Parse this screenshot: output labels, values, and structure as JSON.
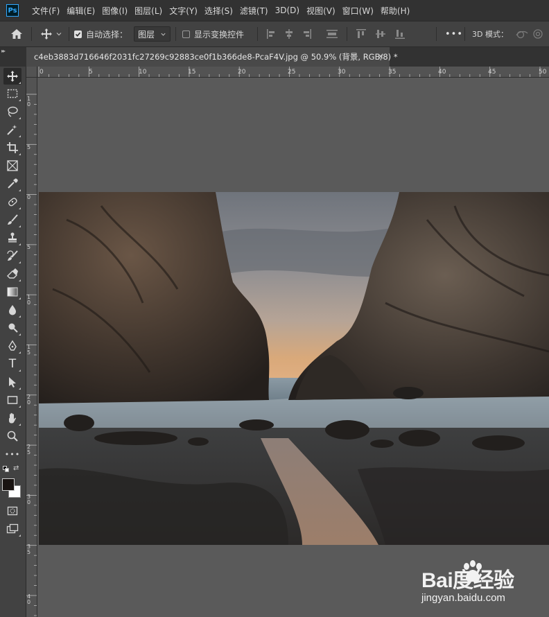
{
  "app": {
    "logo": "Ps"
  },
  "menu": [
    "文件(F)",
    "编辑(E)",
    "图像(I)",
    "图层(L)",
    "文字(Y)",
    "选择(S)",
    "滤镜(T)",
    "3D(D)",
    "视图(V)",
    "窗口(W)",
    "帮助(H)"
  ],
  "options": {
    "auto_select_label": "自动选择：",
    "auto_select_checked": true,
    "auto_select_target": "图层",
    "show_transform_label": "显示变换控件",
    "show_transform_checked": false,
    "more_label": "•••",
    "mode_3d_label": "3D 模式："
  },
  "document": {
    "tab_title": "c4eb3883d716646f2031fc27269c92883ce0f1b366de8-PcaF4V.jpg @ 50.9% (背景, RGB/8) *",
    "close_label": "×"
  },
  "ruler": {
    "top_labels": [
      "0",
      "5",
      "10",
      "15",
      "20",
      "25",
      "30",
      "35",
      "40",
      "45",
      "50"
    ],
    "left_labels": [
      "1",
      "0",
      "5",
      "0",
      "5",
      "1",
      "0",
      "1",
      "5",
      "2",
      "0",
      "2",
      "5",
      "3",
      "0",
      "3",
      "5",
      "4",
      "0"
    ]
  },
  "toolbar": {
    "tools": [
      "move-tool",
      "marquee-tool",
      "lasso-tool",
      "magic-wand-tool",
      "crop-tool",
      "frame-tool",
      "eyedropper-tool",
      "healing-tool",
      "brush-tool",
      "clone-stamp-tool",
      "history-brush-tool",
      "eraser-tool",
      "gradient-tool",
      "blur-tool",
      "dodge-tool",
      "pen-tool",
      "type-tool",
      "path-selection-tool",
      "rectangle-tool",
      "hand-tool",
      "zoom-tool",
      "more-tools",
      "color-swatches",
      "quick-mask",
      "screen-mode"
    ],
    "type_glyph": "T",
    "more_glyph": "•••"
  },
  "colors": {
    "foreground": "#1a1412",
    "background": "#ffffff",
    "accent": "#31a8ff"
  },
  "watermark": {
    "brand": "Bai度经验",
    "url": "jingyan.baidu.com"
  }
}
